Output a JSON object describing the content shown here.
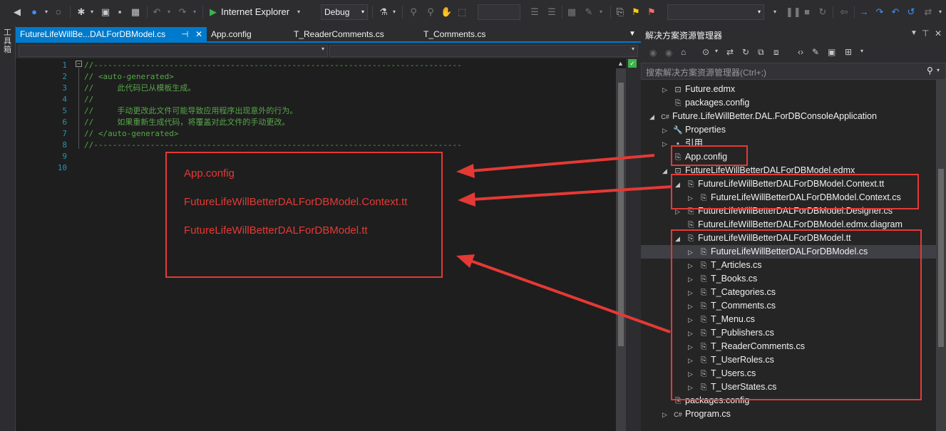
{
  "toolbar": {
    "browser_label": "Internet Explorer",
    "config_label": "Debug"
  },
  "toolbox_label": "工具箱",
  "editor": {
    "tabs": [
      {
        "label": "FutureLifeWillBe...DALForDBModel.cs",
        "active": true
      },
      {
        "label": "App.config",
        "active": false
      },
      {
        "label": "T_ReaderComments.cs",
        "active": false
      },
      {
        "label": "T_Comments.cs",
        "active": false
      }
    ],
    "lines": [
      {
        "n": "1",
        "text": "//------------------------------------------------------------------------------"
      },
      {
        "n": "2",
        "text": "// <auto-generated>"
      },
      {
        "n": "3",
        "text": "//     此代码已从模板生成。"
      },
      {
        "n": "4",
        "text": "//"
      },
      {
        "n": "5",
        "text": "//     手动更改此文件可能导致应用程序出现意外的行为。"
      },
      {
        "n": "6",
        "text": "//     如果重新生成代码，将覆盖对此文件的手动更改。"
      },
      {
        "n": "7",
        "text": "// </auto-generated>"
      },
      {
        "n": "8",
        "text": "//------------------------------------------------------------------------------"
      },
      {
        "n": "9",
        "text": ""
      },
      {
        "n": "10",
        "text": ""
      }
    ]
  },
  "callout": {
    "lines": [
      "App.config",
      "FutureLifeWillBetterDALForDBModel.Context.tt",
      "FutureLifeWillBetterDALForDBModel.tt"
    ]
  },
  "solution_explorer": {
    "title": "解决方案资源管理器",
    "search_placeholder": "搜索解决方案资源管理器(Ctrl+;)",
    "nodes": [
      {
        "label": "Future.edmx",
        "arrow": "▷",
        "icon": "edmx-icon"
      },
      {
        "label": "packages.config",
        "arrow": "",
        "icon": "config-icon"
      },
      {
        "label": "Future.LifeWillBetter.DAL.ForDBConsoleApplication",
        "arrow": "◢",
        "icon": "csharp-project-icon"
      },
      {
        "label": "Properties",
        "arrow": "▷",
        "icon": "wrench-icon"
      },
      {
        "label": "引用",
        "arrow": "▷",
        "icon": "references-icon"
      },
      {
        "label": "App.config",
        "arrow": "",
        "icon": "config-icon"
      },
      {
        "label": "FutureLifeWillBetterDALForDBModel.edmx",
        "arrow": "◢",
        "icon": "edmx-icon"
      },
      {
        "label": "FutureLifeWillBetterDALForDBModel.Context.tt",
        "arrow": "◢",
        "icon": "tt-icon"
      },
      {
        "label": "FutureLifeWillBetterDALForDBModel.Context.cs",
        "arrow": "▷",
        "icon": "cs-file-icon"
      },
      {
        "label": "FutureLifeWillBetterDALForDBModel.Designer.cs",
        "arrow": "▷",
        "icon": "cs-file-icon"
      },
      {
        "label": "FutureLifeWillBetterDALForDBModel.edmx.diagram",
        "arrow": "",
        "icon": "diagram-icon"
      },
      {
        "label": "FutureLifeWillBetterDALForDBModel.tt",
        "arrow": "◢",
        "icon": "tt-icon"
      },
      {
        "label": "FutureLifeWillBetterDALForDBModel.cs",
        "arrow": "▷",
        "icon": "cs-file-icon"
      },
      {
        "label": "T_Articles.cs",
        "arrow": "▷",
        "icon": "cs-file-icon"
      },
      {
        "label": "T_Books.cs",
        "arrow": "▷",
        "icon": "cs-file-icon"
      },
      {
        "label": "T_Categories.cs",
        "arrow": "▷",
        "icon": "cs-file-icon"
      },
      {
        "label": "T_Comments.cs",
        "arrow": "▷",
        "icon": "cs-file-icon"
      },
      {
        "label": "T_Menu.cs",
        "arrow": "▷",
        "icon": "cs-file-icon"
      },
      {
        "label": "T_Publishers.cs",
        "arrow": "▷",
        "icon": "cs-file-icon"
      },
      {
        "label": "T_ReaderComments.cs",
        "arrow": "▷",
        "icon": "cs-file-icon"
      },
      {
        "label": "T_UserRoles.cs",
        "arrow": "▷",
        "icon": "cs-file-icon"
      },
      {
        "label": "T_Users.cs",
        "arrow": "▷",
        "icon": "cs-file-icon"
      },
      {
        "label": "T_UserStates.cs",
        "arrow": "▷",
        "icon": "cs-file-icon"
      },
      {
        "label": "packages.config",
        "arrow": "",
        "icon": "config-icon"
      },
      {
        "label": "Program.cs",
        "arrow": "▷",
        "icon": "csharp-file-icon"
      }
    ]
  },
  "colors": {
    "accent": "#007acc",
    "annotation": "#e53935",
    "comment": "#57a64a",
    "line_number": "#2b91af"
  }
}
